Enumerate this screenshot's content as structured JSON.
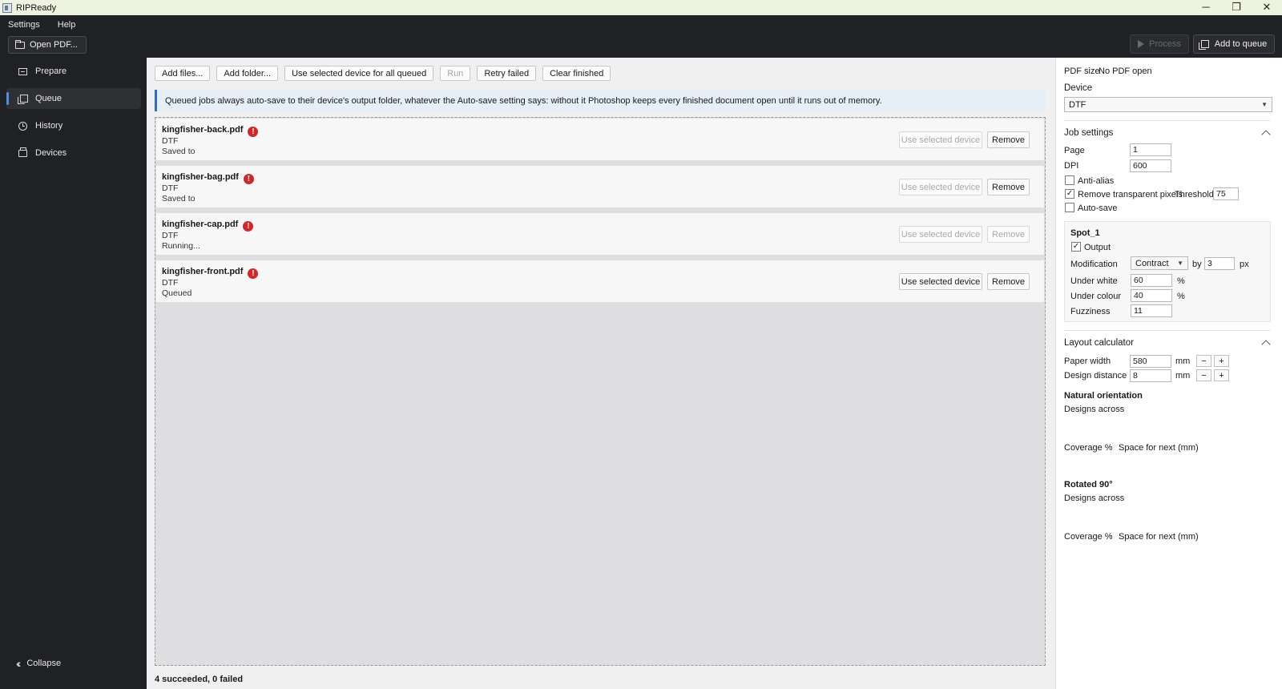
{
  "window": {
    "title": "RIPReady",
    "minimize": "─",
    "restore": "❐",
    "close": "✕"
  },
  "menu": {
    "settings": "Settings",
    "help": "Help"
  },
  "header": {
    "open_pdf": "Open PDF...",
    "process": "Process",
    "add_to_queue": "Add to queue"
  },
  "sidebar": {
    "items": [
      {
        "label": "Prepare",
        "icon": "prepare-icon"
      },
      {
        "label": "Queue",
        "icon": "queue-icon",
        "active": true
      },
      {
        "label": "History",
        "icon": "history-icon"
      },
      {
        "label": "Devices",
        "icon": "devices-icon"
      }
    ],
    "collapse": "Collapse"
  },
  "toolbar": {
    "add_files": "Add files...",
    "add_folder": "Add folder...",
    "use_selected_all": "Use selected device for all queued",
    "run": "Run",
    "retry_failed": "Retry failed",
    "clear_finished": "Clear finished"
  },
  "info": "Queued jobs always auto-save to their device's output folder, whatever the Auto-save setting says: without it Photoshop keeps every finished document open until it runs out of memory.",
  "jobs": [
    {
      "name": "kingfisher-back.pdf",
      "device": "DTF",
      "status": "Saved to",
      "use_label": "Use selected device",
      "remove_label": "Remove",
      "use_enabled": false,
      "remove_enabled": true
    },
    {
      "name": "kingfisher-bag.pdf",
      "device": "DTF",
      "status": "Saved to",
      "use_label": "Use selected device",
      "remove_label": "Remove",
      "use_enabled": false,
      "remove_enabled": true
    },
    {
      "name": "kingfisher-cap.pdf",
      "device": "DTF",
      "status": "Running...",
      "use_label": "Use selected device",
      "remove_label": "Remove",
      "use_enabled": false,
      "remove_enabled": false
    },
    {
      "name": "kingfisher-front.pdf",
      "device": "DTF",
      "status": "Queued",
      "use_label": "Use selected device",
      "remove_label": "Remove",
      "use_enabled": true,
      "remove_enabled": true
    }
  ],
  "summary": "4 succeeded, 0 failed",
  "panel": {
    "pdf_size_label": "PDF size",
    "pdf_size_value": "No PDF open",
    "device_label": "Device",
    "device_value": "DTF",
    "job_settings": {
      "title": "Job settings",
      "page_label": "Page",
      "page_value": "1",
      "dpi_label": "DPI",
      "dpi_value": "600",
      "antialias_label": "Anti-alias",
      "antialias_checked": false,
      "remove_transparent_label": "Remove transparent pixels",
      "remove_transparent_checked": true,
      "threshold_label": "Threshold",
      "threshold_value": "75",
      "autosave_label": "Auto-save",
      "autosave_checked": false
    },
    "spot": {
      "title": "Spot_1",
      "output_label": "Output",
      "output_checked": true,
      "modification_label": "Modification",
      "modification_value": "Contract",
      "by_label": "by",
      "by_value": "3",
      "by_unit": "px",
      "under_white_label": "Under white",
      "under_white_value": "60",
      "under_white_unit": "%",
      "under_colour_label": "Under colour",
      "under_colour_value": "40",
      "under_colour_unit": "%",
      "fuzziness_label": "Fuzziness",
      "fuzziness_value": "11"
    },
    "layout": {
      "title": "Layout calculator",
      "paper_width_label": "Paper width",
      "paper_width_value": "580",
      "paper_width_unit": "mm",
      "design_distance_label": "Design distance",
      "design_distance_value": "8",
      "design_distance_unit": "mm",
      "minus": "−",
      "plus": "+",
      "natural_title": "Natural orientation",
      "natural_designs_across": "Designs across",
      "natural_coverage": "Coverage %",
      "natural_space": "Space for next (mm)",
      "rotated_title": "Rotated 90°",
      "rotated_designs_across": "Designs across",
      "rotated_coverage": "Coverage %",
      "rotated_space": "Space for next (mm)"
    }
  },
  "colors": {
    "accent": "#4f8ee8",
    "error": "#d32626",
    "info_border": "#2a6fd1"
  }
}
